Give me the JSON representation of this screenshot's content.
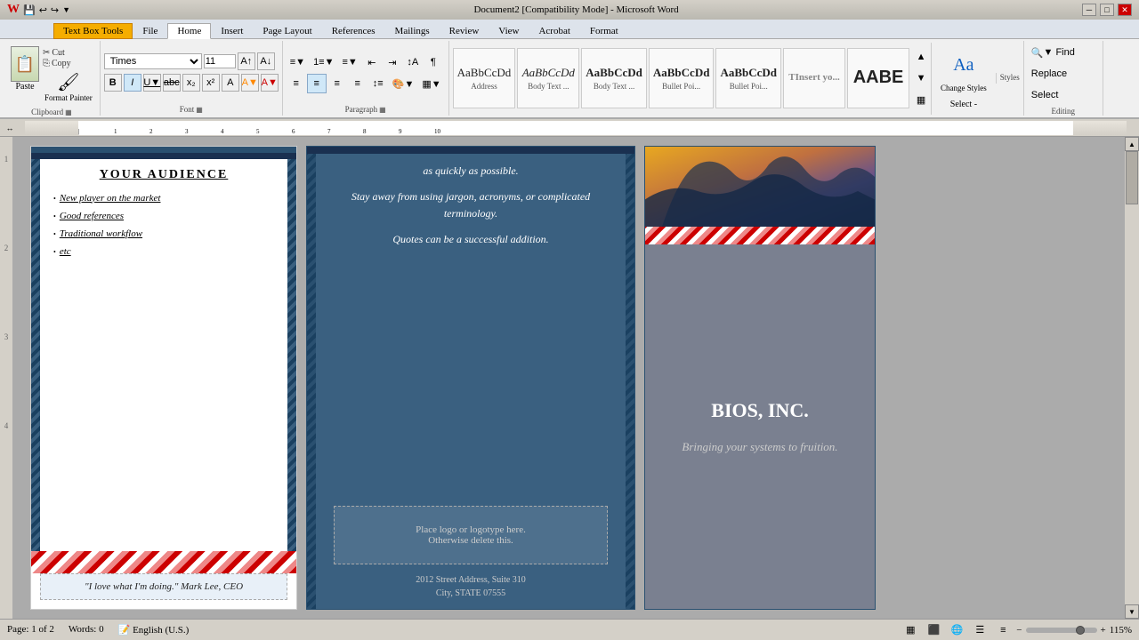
{
  "titlebar": {
    "title": "Document2 [Compatibility Mode] - Microsoft Word",
    "app_icon": "W",
    "min_btn": "─",
    "max_btn": "□",
    "close_btn": "✕"
  },
  "ribbon_tabs": {
    "textbox_tools_label": "Text Box Tools",
    "tabs": [
      "File",
      "Home",
      "Insert",
      "Page Layout",
      "References",
      "Mailings",
      "Review",
      "View",
      "Acrobat",
      "Format"
    ]
  },
  "clipboard": {
    "label": "Clipboard",
    "paste_label": "Paste",
    "cut_label": "Cut",
    "copy_label": "Copy",
    "format_painter_label": "Format Painter"
  },
  "font": {
    "label": "Font",
    "font_name": "Times",
    "font_size": "11",
    "bold": "B",
    "italic": "I",
    "underline": "U",
    "strikethrough": "abc",
    "subscript": "x₂",
    "superscript": "x²"
  },
  "paragraph": {
    "label": "Paragraph"
  },
  "styles": {
    "label": "Styles",
    "items": [
      {
        "preview": "AaBbCcDd",
        "label": "Address"
      },
      {
        "preview": "AaBbCcDd",
        "label": "Body Text ..."
      },
      {
        "preview": "AaBbCcDd",
        "label": "Body Text ..."
      },
      {
        "preview": "AaBbCcDd",
        "label": "Bullet Poi..."
      },
      {
        "preview": "AaBbCcDd",
        "label": "Bullet Poi..."
      },
      {
        "preview": "TInsert yo...",
        "label": ""
      },
      {
        "preview": "AABE",
        "label": ""
      }
    ],
    "change_styles_label": "Change Styles",
    "select_label": "Select -"
  },
  "editing": {
    "label": "Editing",
    "find_label": "▼ Find",
    "replace_label": "Replace",
    "select_label": "Select"
  },
  "document": {
    "left_panel": {
      "title": "YOUR AUDIENCE",
      "bullets": [
        "New player on the market",
        "Good references",
        "Traditional workflow",
        "etc"
      ],
      "quote": "\"I love what I'm doing.\" Mark Lee, CEO"
    },
    "middle_panel": {
      "text1": "as quickly as possible.",
      "text2": "Stay away from using jargon, acronyms, or complicated terminology.",
      "text3": "Quotes can be a successful addition.",
      "logo_text": "Place logo  or logotype here.",
      "logo_text2": "Otherwise delete this.",
      "address1": "2012 Street Address,  Suite 310",
      "address2": "City, STATE 07555"
    },
    "right_panel": {
      "company_name": "BIOS, INC.",
      "tagline": "Bringing your systems to fruition."
    }
  },
  "status_bar": {
    "page_info": "Page: 1 of 2",
    "word_count": "Words: 0",
    "language": "English (U.S.)",
    "zoom": "115%"
  }
}
